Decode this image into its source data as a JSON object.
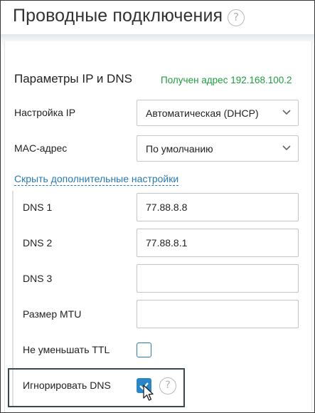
{
  "header": {
    "title": "Проводные подключения",
    "help_icon": "?"
  },
  "section": {
    "title": "Параметры IP и DNS",
    "status": "Получен адрес 192.168.100.2"
  },
  "ip_setting": {
    "label": "Настройка IP",
    "value": "Автоматическая (DHCP)"
  },
  "mac": {
    "label": "MAC-адрес",
    "value": "По умолчанию"
  },
  "toggle_link": "Скрыть дополнительные настройки",
  "dns1": {
    "label": "DNS 1",
    "value": "77.88.8.8"
  },
  "dns2": {
    "label": "DNS 2",
    "value": "77.88.8.1"
  },
  "dns3": {
    "label": "DNS 3",
    "value": ""
  },
  "mtu": {
    "label": "Размер MTU",
    "value": ""
  },
  "ttl": {
    "label": "Не уменьшать TTL",
    "checked": false
  },
  "ignore_dns": {
    "label": "Игнорировать DNS",
    "checked": true,
    "help_icon": "?"
  },
  "colors": {
    "accent": "#2a86c4",
    "link": "#2a7ab0",
    "status": "#1e9e3e"
  }
}
